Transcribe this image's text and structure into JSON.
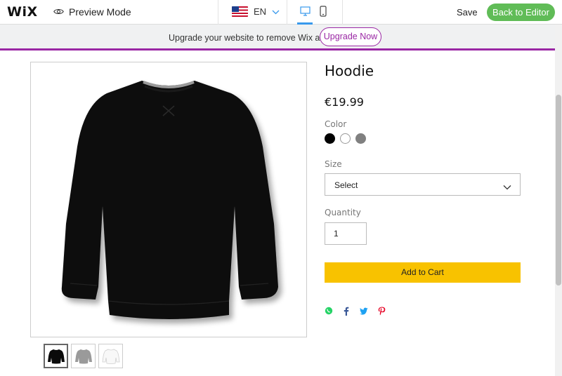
{
  "topbar": {
    "logo": "WiX",
    "preview_mode": "Preview Mode",
    "language": "EN",
    "save_label": "Save",
    "back_label": "Back to Editor"
  },
  "banner": {
    "text": "Upgrade your website to remove Wix ads",
    "button": "Upgrade Now"
  },
  "product": {
    "name": "Hoodie",
    "price": "€19.99",
    "color_label": "Color",
    "colors": [
      "#000000",
      "#ffffff",
      "#808080"
    ],
    "size_label": "Size",
    "size_value": "Select",
    "quantity_label": "Quantity",
    "quantity_value": "1",
    "add_to_cart": "Add to Cart"
  },
  "colors": {
    "brand_purple": "#9a27a4",
    "editor_green": "#60bc57",
    "cart_yellow": "#f8c200"
  }
}
